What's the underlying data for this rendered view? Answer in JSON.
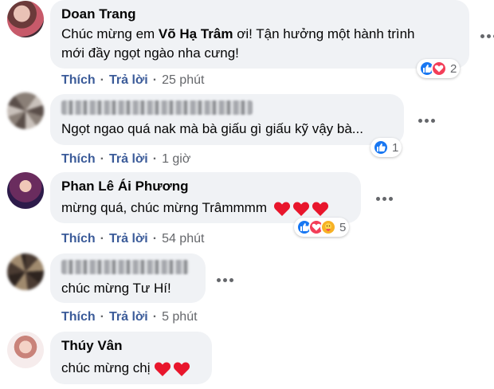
{
  "colors": {
    "like": "#1877f2",
    "love": "#f33e58",
    "care": "#f7b125",
    "bubble": "#f0f2f5",
    "action": "#3b5b99",
    "meta": "#65676b"
  },
  "comments": [
    {
      "author": "Doan Trang",
      "text_before": "Chúc mừng em ",
      "text_bold": "Võ Hạ Trâm",
      "text_after": " ơi! Tận hưởng một hành trình",
      "text_line2": "mới đầy ngọt ngào nha cưng!",
      "reactions": [
        "like",
        "love"
      ],
      "reaction_count": "2",
      "like_label": "Thích",
      "reply_label": "Trả lời",
      "time": "25 phút"
    },
    {
      "author_blurred": true,
      "text": "Ngọt ngao quá nak mà bà giấu gì giấu kỹ vậy bà...",
      "reactions": [
        "like"
      ],
      "reaction_count": "1",
      "like_label": "Thích",
      "reply_label": "Trả lời",
      "time": "1 giờ"
    },
    {
      "author": "Phan Lê Ái Phương",
      "text": "mừng quá, chúc mừng Trâmmmm",
      "heart_emoji_count": 3,
      "reactions": [
        "like",
        "love",
        "care"
      ],
      "reaction_count": "5",
      "like_label": "Thích",
      "reply_label": "Trả lời",
      "time": "54 phút"
    },
    {
      "author_blurred": true,
      "text": "chúc mừng Tư Hí!",
      "like_label": "Thích",
      "reply_label": "Trả lời",
      "time": "5 phút"
    },
    {
      "author": "Thúy Vân",
      "text": "chúc mừng chị",
      "heart_emoji_count": 2
    }
  ]
}
